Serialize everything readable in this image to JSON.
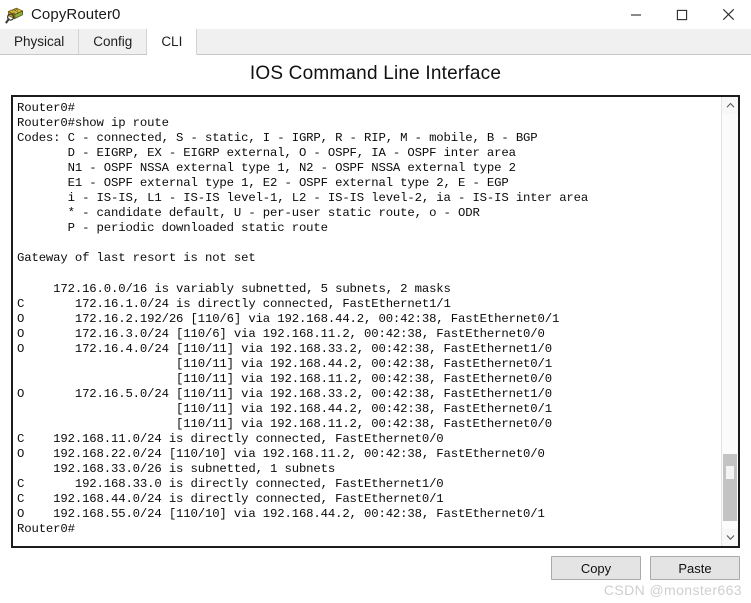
{
  "window": {
    "title": "CopyRouter0",
    "icon": "router-money-icon",
    "controls": [
      {
        "name": "minimize-button",
        "glyph": "minimize-icon"
      },
      {
        "name": "maximize-button",
        "glyph": "maximize-icon"
      },
      {
        "name": "close-button",
        "glyph": "close-icon"
      }
    ]
  },
  "tabs": [
    {
      "label": "Physical",
      "active": false
    },
    {
      "label": "Config",
      "active": false
    },
    {
      "label": "CLI",
      "active": true
    }
  ],
  "heading": {
    "title": "IOS Command Line Interface"
  },
  "terminal": {
    "lines": [
      "Router0#",
      "Router0#show ip route",
      "Codes: C - connected, S - static, I - IGRP, R - RIP, M - mobile, B - BGP",
      "       D - EIGRP, EX - EIGRP external, O - OSPF, IA - OSPF inter area",
      "       N1 - OSPF NSSA external type 1, N2 - OSPF NSSA external type 2",
      "       E1 - OSPF external type 1, E2 - OSPF external type 2, E - EGP",
      "       i - IS-IS, L1 - IS-IS level-1, L2 - IS-IS level-2, ia - IS-IS inter area",
      "       * - candidate default, U - per-user static route, o - ODR",
      "       P - periodic downloaded static route",
      "",
      "Gateway of last resort is not set",
      "",
      "     172.16.0.0/16 is variably subnetted, 5 subnets, 2 masks",
      "C       172.16.1.0/24 is directly connected, FastEthernet1/1",
      "O       172.16.2.192/26 [110/6] via 192.168.44.2, 00:42:38, FastEthernet0/1",
      "O       172.16.3.0/24 [110/6] via 192.168.11.2, 00:42:38, FastEthernet0/0",
      "O       172.16.4.0/24 [110/11] via 192.168.33.2, 00:42:38, FastEthernet1/0",
      "                      [110/11] via 192.168.44.2, 00:42:38, FastEthernet0/1",
      "                      [110/11] via 192.168.11.2, 00:42:38, FastEthernet0/0",
      "O       172.16.5.0/24 [110/11] via 192.168.33.2, 00:42:38, FastEthernet1/0",
      "                      [110/11] via 192.168.44.2, 00:42:38, FastEthernet0/1",
      "                      [110/11] via 192.168.11.2, 00:42:38, FastEthernet0/0",
      "C    192.168.11.0/24 is directly connected, FastEthernet0/0",
      "O    192.168.22.0/24 [110/10] via 192.168.11.2, 00:42:38, FastEthernet0/0",
      "     192.168.33.0/26 is subnetted, 1 subnets",
      "C       192.168.33.0 is directly connected, FastEthernet1/0",
      "C    192.168.44.0/24 is directly connected, FastEthernet0/1",
      "O    192.168.55.0/24 [110/10] via 192.168.44.2, 00:42:38, FastEthernet0/1",
      "Router0#"
    ]
  },
  "scrollbar": {
    "up_arrow": "chevron-up-icon",
    "down_arrow": "chevron-down-icon",
    "thumb_top_pct": 82,
    "thumb_height_pct": 16
  },
  "actions": {
    "copy_label": "Copy",
    "paste_label": "Paste"
  },
  "watermark": {
    "text": "CSDN @monster663"
  },
  "colors": {
    "tab_bar": "#f0f0f0",
    "active_tab": "#ffffff",
    "terminal_bg": "#ffffff",
    "terminal_text": "#0b0b0b",
    "terminal_border": "#1c1c1c",
    "button_face": "#e4e4e4",
    "watermark": "#cfcfcf"
  }
}
